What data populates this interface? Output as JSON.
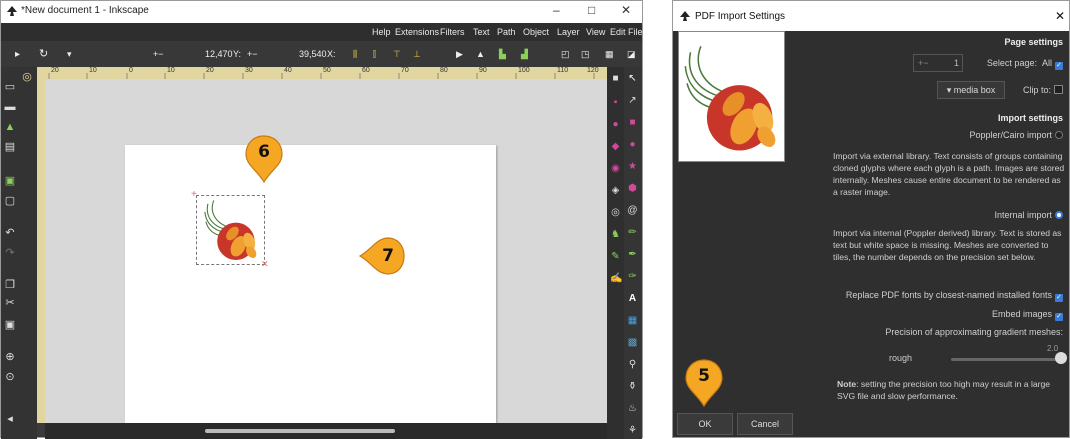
{
  "inkscape": {
    "title": "*New document 1 - Inkscape",
    "window_controls": {
      "minimize": "–",
      "maximize": "□",
      "close": "✕"
    },
    "menu": [
      "Help",
      "Extensions",
      "Filters",
      "Text",
      "Path",
      "Object",
      "Layer",
      "View",
      "Edit",
      "File"
    ],
    "toolbar": {
      "w_value": "12,470",
      "y_label": "Y:",
      "x_value": "39,540",
      "x_label": "X:",
      "plusminus": "+−"
    },
    "ruler_top": [
      "20",
      "10",
      "0",
      "10",
      "20",
      "30",
      "40",
      "50",
      "60",
      "70",
      "80",
      "90",
      "100",
      "110",
      "120"
    ]
  },
  "dialog": {
    "title": "PDF Import Settings",
    "close": "✕",
    "page_settings_heading": "Page settings",
    "page_number": "1",
    "select_page_label": "Select page:",
    "all_label": "All",
    "media_box": "▾ media box",
    "clip_to_label": "Clip to:",
    "import_settings_heading": "Import settings",
    "poppler_cairo_label": "Poppler/Cairo import",
    "poppler_desc": "Import via external library. Text consists of groups containing cloned glyphs where each glyph is a path. Images are stored internally. Meshes cause entire document to be rendered as a raster image.",
    "internal_label": "Internal import",
    "internal_desc": "Import via internal (Poppler derived) library. Text is stored as text but white space is missing. Meshes are converted to tiles, the number depends on the precision set below.",
    "replace_fonts_label": "Replace PDF fonts by closest-named installed fonts",
    "embed_images_label": "Embed images",
    "precision_label": "Precision of approximating gradient meshes:",
    "slider_value": "2.0",
    "slider_level": 1.0,
    "rough_label": "rough",
    "note_bold": "Note",
    "note_text": ": setting the precision too high may result in a large SVG file and slow performance.",
    "ok_label": "OK",
    "cancel_label": "Cancel"
  },
  "callouts": {
    "five": "5",
    "six": "6",
    "seven": "7"
  },
  "colors": {
    "callout_fill": "#f5a623",
    "callout_stroke": "#c77a12",
    "accent_blue": "#3a7bd5",
    "logo_red": "#c8362a",
    "logo_orange": "#f0a030",
    "logo_green": "#4a7a3a"
  }
}
